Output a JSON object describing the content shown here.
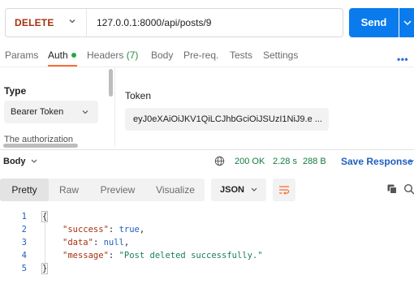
{
  "request": {
    "method": "DELETE",
    "url": "127.0.0.1:8000/api/posts/9",
    "send_label": "Send"
  },
  "request_tabs": {
    "params": "Params",
    "auth": "Auth",
    "headers": "Headers",
    "headers_count": "(7)",
    "body": "Body",
    "prereq": "Pre-req.",
    "tests": "Tests",
    "settings": "Settings",
    "more": "•••"
  },
  "auth": {
    "type_label": "Type",
    "type_value": "Bearer Token",
    "note": "The authorization",
    "token_label": "Token",
    "token_value": "eyJ0eXAiOiJKV1QiLCJhbGciOiJSUzI1NiJ9.e ..."
  },
  "response": {
    "body_label": "Body",
    "status": "200 OK",
    "time": "2.28 s",
    "size": "288 B",
    "save_label": "Save Response",
    "views": [
      "Pretty",
      "Raw",
      "Preview",
      "Visualize"
    ],
    "active_view": "Pretty",
    "format": "JSON",
    "line_numbers": [
      "1",
      "2",
      "3",
      "4",
      "5"
    ],
    "json": {
      "open_brace": "{",
      "close_brace": "}",
      "key_success": "\"success\"",
      "val_success": "true",
      "key_data": "\"data\"",
      "val_data": "null",
      "key_message": "\"message\"",
      "val_message": "\"Post deleted successfully.\""
    }
  },
  "colors": {
    "accent": "#097bed",
    "method": "#a5310f",
    "status_ok": "#0f7b3f",
    "auth_dot": "#28a745",
    "tab_underline": "#ff6c37"
  },
  "icons": [
    "chevron-down-icon",
    "globe-icon",
    "wrap-lines-icon",
    "copy-icon",
    "search-icon"
  ]
}
